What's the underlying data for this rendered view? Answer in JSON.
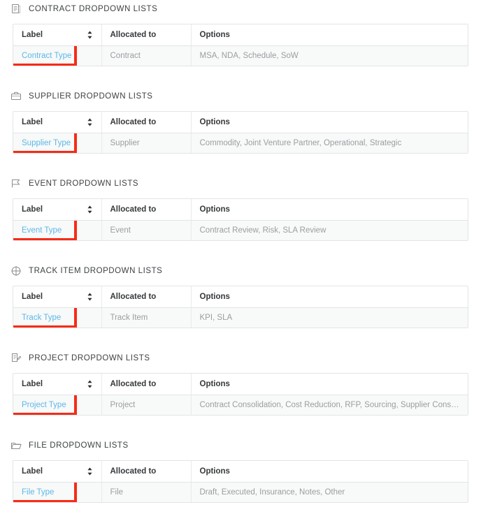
{
  "table_columns": [
    "Label",
    "Allocated to",
    "Options"
  ],
  "sections": [
    {
      "id": "contract",
      "icon": "document-icon",
      "title": "CONTRACT DROPDOWN LISTS",
      "rows": [
        {
          "label": "Contract Type",
          "allocated_to": "Contract",
          "options": "MSA, NDA, Schedule, SoW",
          "highlighted": true
        }
      ]
    },
    {
      "id": "supplier",
      "icon": "briefcase-icon",
      "title": "SUPPLIER DROPDOWN LISTS",
      "rows": [
        {
          "label": "Supplier Type",
          "allocated_to": "Supplier",
          "options": "Commodity, Joint Venture Partner, Operational, Strategic",
          "highlighted": true
        }
      ]
    },
    {
      "id": "event",
      "icon": "flag-icon",
      "title": "EVENT DROPDOWN LISTS",
      "rows": [
        {
          "label": "Event Type",
          "allocated_to": "Event",
          "options": "Contract Review, Risk, SLA Review",
          "highlighted": true
        }
      ]
    },
    {
      "id": "track-item",
      "icon": "target-icon",
      "title": "TRACK ITEM DROPDOWN LISTS",
      "rows": [
        {
          "label": "Track Type",
          "allocated_to": "Track Item",
          "options": "KPI, SLA",
          "highlighted": true
        }
      ]
    },
    {
      "id": "project",
      "icon": "document-pen-icon",
      "title": "PROJECT DROPDOWN LISTS",
      "rows": [
        {
          "label": "Project Type",
          "allocated_to": "Project",
          "options": "Contract Consolidation, Cost Reduction, RFP, Sourcing, Supplier Consolidation",
          "highlighted": true
        }
      ]
    },
    {
      "id": "file",
      "icon": "folder-icon",
      "title": "FILE DROPDOWN LISTS",
      "rows": [
        {
          "label": "File Type",
          "allocated_to": "File",
          "options": "Draft, Executed, Insurance, Notes, Other",
          "highlighted": true
        }
      ]
    }
  ],
  "colors": {
    "link": "#5bb8e8",
    "highlight": "#f72b17",
    "row_background": "#f8f9f9",
    "border": "#e2e4e6",
    "muted_text": "#9a9da0",
    "heading_text": "#3d4043"
  },
  "icons": {
    "sort": "sort-arrows-icon"
  }
}
